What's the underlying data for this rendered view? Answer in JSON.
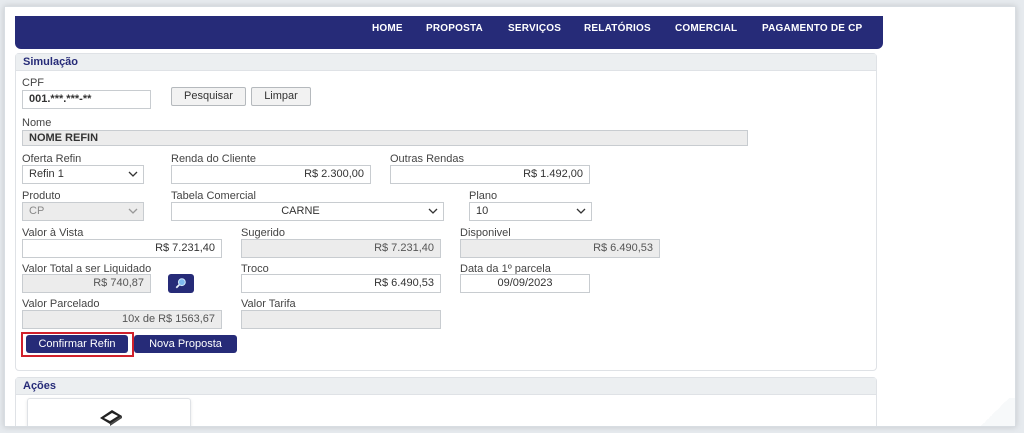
{
  "nav": [
    "HOME",
    "PROPOSTA",
    "SERVIÇOS",
    "RELATÓRIOS",
    "COMERCIAL",
    "PAGAMENTO DE CP"
  ],
  "simulacao": {
    "title": "Simulação",
    "cpf_label": "CPF",
    "cpf_value": "001.***.***-**",
    "pesquisar": "Pesquisar",
    "limpar": "Limpar",
    "nome_label": "Nome",
    "nome_value": "NOME REFIN",
    "oferta_label": "Oferta Refin",
    "oferta_value": "Refin 1",
    "renda_label": "Renda do Cliente",
    "renda_value": "R$ 2.300,00",
    "outras_label": "Outras Rendas",
    "outras_value": "R$ 1.492,00",
    "produto_label": "Produto",
    "produto_value": "CP",
    "tabela_label": "Tabela Comercial",
    "tabela_value": "CARNE",
    "plano_label": "Plano",
    "plano_value": "10",
    "vista_label": "Valor à Vista",
    "vista_value": "R$ 7.231,40",
    "sugerido_label": "Sugerido",
    "sugerido_value": "R$ 7.231,40",
    "disponivel_label": "Disponivel",
    "disponivel_value": "R$ 6.490,53",
    "total_label": "Valor Total a ser Liquidado",
    "total_value": "R$ 740,87",
    "troco_label": "Troco",
    "troco_value": "R$ 6.490,53",
    "data_label": "Data da 1º parcela",
    "data_value": "09/09/2023",
    "parcelado_label": "Valor Parcelado",
    "parcelado_value": "10x de R$ 1563,67",
    "tarifa_label": "Valor Tarifa",
    "tarifa_value": "",
    "confirmar": "Confirmar Refin",
    "nova": "Nova Proposta"
  },
  "acoes": {
    "title": "Ações"
  },
  "colors": {
    "primary": "#262b78",
    "highlight": "#d0212c"
  },
  "icons": {
    "search_details": "magnifier-icon",
    "action": "scanner-icon"
  }
}
